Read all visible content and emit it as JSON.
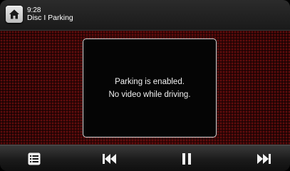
{
  "header": {
    "time": "9:28",
    "source": "Disc I Parking"
  },
  "message": {
    "line1": "Parking is enabled.",
    "line2": "No video while driving."
  },
  "icons": {
    "home": "home-icon",
    "list": "list-icon",
    "previous": "skip-previous-icon",
    "pause": "pause-icon",
    "next": "skip-next-icon"
  },
  "colors": {
    "background_texture": "#2a0505",
    "accent_white": "#ffffff"
  }
}
